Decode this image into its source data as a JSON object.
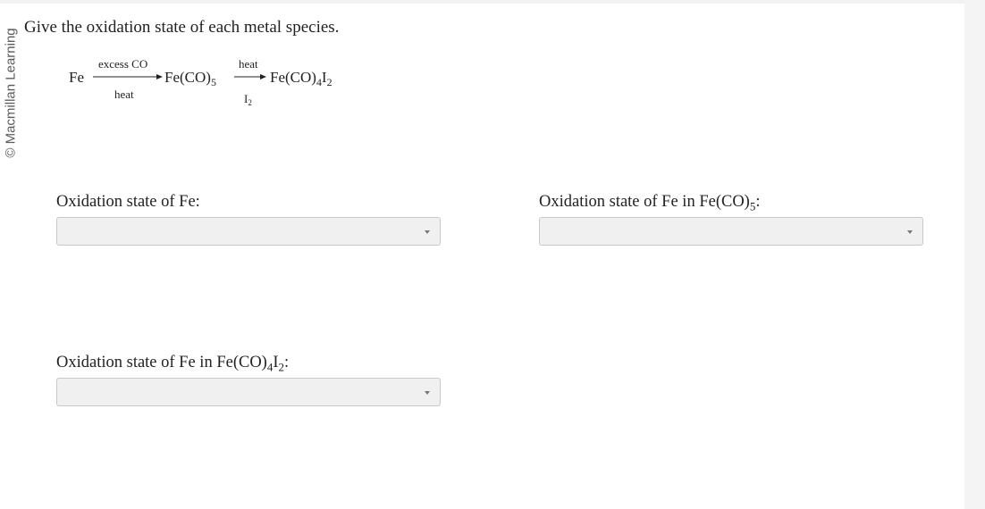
{
  "watermark": "© Macmillan Learning",
  "question": "Give the oxidation state of each metal species.",
  "reaction": {
    "reactant": "Fe",
    "arrow1_top": "excess CO",
    "arrow1_bottom": "heat",
    "product1": {
      "base": "Fe(CO)",
      "sub": "5"
    },
    "arrow2_top": "heat",
    "arrow2_bottom": {
      "base": "I",
      "sub": "2"
    },
    "product2": {
      "base": "Fe(CO)",
      "sub1": "4",
      "mid": "I",
      "sub2": "2"
    }
  },
  "fields": {
    "fe": {
      "label": "Oxidation state of Fe:",
      "value": ""
    },
    "feco5": {
      "label_prefix": "Oxidation state of Fe in Fe(CO)",
      "sub": "5",
      "label_suffix": ":",
      "value": ""
    },
    "feco4i2": {
      "label_prefix": "Oxidation state of Fe in Fe(CO)",
      "sub1": "4",
      "mid": "I",
      "sub2": "2",
      "label_suffix": ":",
      "value": ""
    }
  }
}
